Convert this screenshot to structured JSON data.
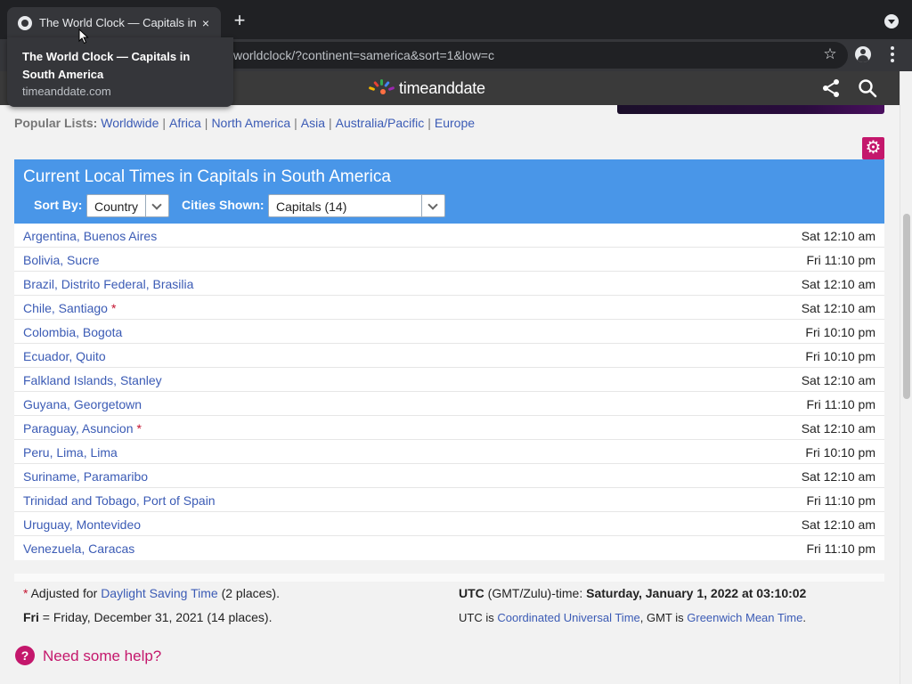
{
  "browser": {
    "tab_title": "The World Clock — Capitals in South America",
    "tab_close": "×",
    "new_tab": "+",
    "url": "worldclock/?continent=samerica&sort=1&low=c",
    "star": "☆"
  },
  "tooltip": {
    "title": "The World Clock — Capitals in South America",
    "domain": "timeanddate.com"
  },
  "site": {
    "logo_text": "timeanddate",
    "popular_label": "Popular Lists:",
    "popular_links": [
      "Worldwide",
      "Africa",
      "North America",
      "Asia",
      "Australia/Pacific",
      "Europe"
    ],
    "settings_icon": "⚙"
  },
  "panel": {
    "title": "Current Local Times in Capitals in South America",
    "sort_label": "Sort By:",
    "sort_value": "Country",
    "cities_label": "Cities Shown:",
    "cities_value": "Capitals (14)",
    "rows": [
      {
        "city": "Argentina, Buenos Aires",
        "dst": "",
        "time": "Sat 12:10 am"
      },
      {
        "city": "Bolivia, Sucre",
        "dst": "",
        "time": "Fri 11:10 pm"
      },
      {
        "city": "Brazil, Distrito Federal, Brasilia",
        "dst": "",
        "time": "Sat 12:10 am"
      },
      {
        "city": "Chile, Santiago",
        "dst": "*",
        "time": "Sat 12:10 am"
      },
      {
        "city": "Colombia, Bogota",
        "dst": "",
        "time": "Fri 10:10 pm"
      },
      {
        "city": "Ecuador, Quito",
        "dst": "",
        "time": "Fri 10:10 pm"
      },
      {
        "city": "Falkland Islands, Stanley",
        "dst": "",
        "time": "Sat 12:10 am"
      },
      {
        "city": "Guyana, Georgetown",
        "dst": "",
        "time": "Fri 11:10 pm"
      },
      {
        "city": "Paraguay, Asuncion",
        "dst": "*",
        "time": "Sat 12:10 am"
      },
      {
        "city": "Peru, Lima, Lima",
        "dst": "",
        "time": "Fri 10:10 pm"
      },
      {
        "city": "Suriname, Paramaribo",
        "dst": "",
        "time": "Sat 12:10 am"
      },
      {
        "city": "Trinidad and Tobago, Port of Spain",
        "dst": "",
        "time": "Fri 11:10 pm"
      },
      {
        "city": "Uruguay, Montevideo",
        "dst": "",
        "time": "Sat 12:10 am"
      },
      {
        "city": "Venezuela, Caracas",
        "dst": "",
        "time": "Fri 11:10 pm"
      }
    ]
  },
  "footnotes": {
    "dst_star": "*",
    "dst_prefix": "Adjusted for",
    "dst_link": "Daylight Saving Time",
    "dst_suffix": "(2 places).",
    "fri_abbr": "Fri",
    "fri_text": "= Friday, December 31, 2021 (14 places).",
    "utc_label": "UTC",
    "utc_paren": "(GMT/Zulu)-time:",
    "utc_value": "Saturday, January 1, 2022 at 03:10:02",
    "utc_is": "UTC is",
    "utc_link": "Coordinated Universal Time",
    "gmt_is": ", GMT is",
    "gmt_link": "Greenwich Mean Time",
    "period": "."
  },
  "help": {
    "icon": "?",
    "text": "Need some help?"
  },
  "colors": {
    "panel_header": "#4996e8",
    "link": "#3b5bb5",
    "brand_magenta": "#c4176c",
    "dst_red": "#c4122f"
  }
}
